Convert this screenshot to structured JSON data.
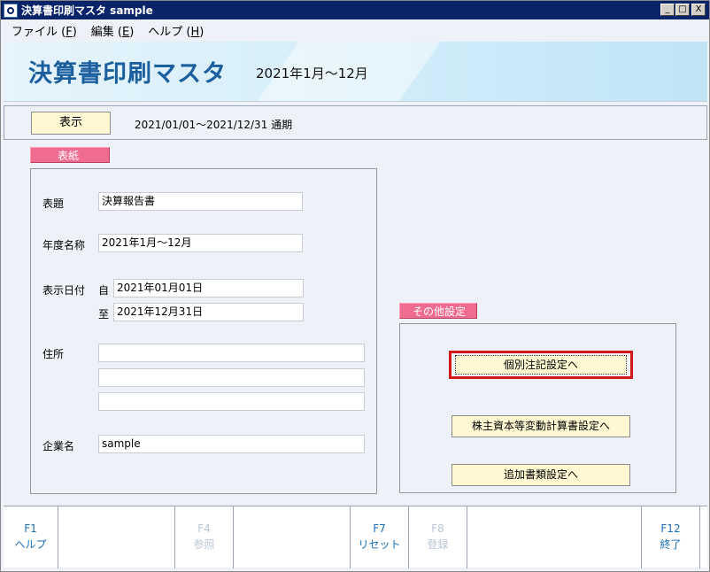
{
  "window": {
    "title": "決算書印刷マスタ sample",
    "controls": {
      "minimize": "_",
      "maximize": "□",
      "close": "X"
    }
  },
  "menu": {
    "items": [
      {
        "label": "ファイル (",
        "key": "F",
        "tail": ")"
      },
      {
        "label": "編集 (",
        "key": "E",
        "tail": ")"
      },
      {
        "label": "ヘルプ (",
        "key": "H",
        "tail": ")"
      }
    ]
  },
  "header": {
    "title": "決算書印刷マスタ",
    "subtitle": "2021年1月～12月"
  },
  "period": {
    "display_button": "表示",
    "range_text": "2021/01/01～2021/12/31  通期"
  },
  "cover": {
    "section_label": "表紙",
    "title_label": "表題",
    "title_value": "決算報告書",
    "year_label": "年度名称",
    "year_value": "2021年1月～12月",
    "date_label": "表示日付",
    "from_label": "自",
    "from_value": "2021年01月01日",
    "to_label": "至",
    "to_value": "2021年12月31日",
    "address_label": "住所",
    "address_line1": "",
    "address_line2": "",
    "address_line3": "",
    "company_label": "企業名",
    "company_value": "sample"
  },
  "other": {
    "section_label": "その他設定",
    "notes_button": "個別注記設定へ",
    "equity_button": "株主資本等変動計算書設定へ",
    "additional_button": "追加書類設定へ"
  },
  "fkeys": [
    {
      "name": "F1",
      "label": "ヘルプ",
      "enabled": true
    },
    {
      "name": "",
      "label": "",
      "enabled": false
    },
    {
      "name": "F4",
      "label": "参照",
      "enabled": false
    },
    {
      "name": "",
      "label": "",
      "enabled": false
    },
    {
      "name": "F7",
      "label": "リセット",
      "enabled": true
    },
    {
      "name": "F8",
      "label": "登録",
      "enabled": false
    },
    {
      "name": "",
      "label": "",
      "enabled": false
    },
    {
      "name": "F12",
      "label": "終了",
      "enabled": true
    }
  ],
  "colors": {
    "title_bar": "#0a246a",
    "banner_title": "#1b5f9e",
    "section_label_bg": "#f06b90",
    "button_bg": "#fff8d2",
    "focus_ring": "#d41818",
    "fkey_text": "#1c6fb5",
    "fkey_disabled": "#b9c6d6"
  }
}
